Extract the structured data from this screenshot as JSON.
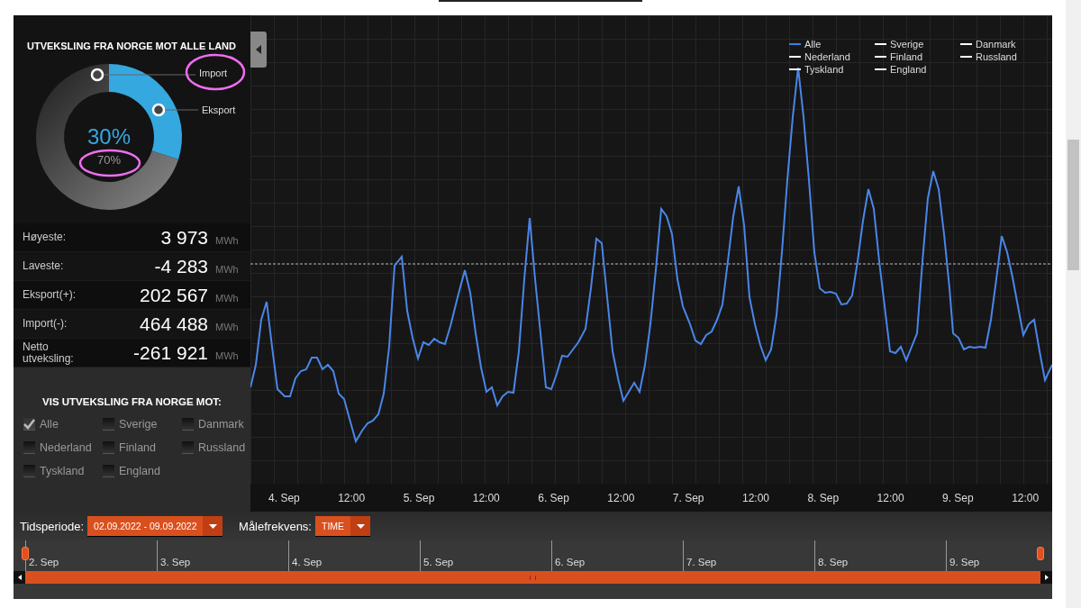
{
  "donut_panel": {
    "title": "UTVEKSLING FRA NORGE MOT ALLE LAND",
    "chart_data": {
      "type": "donut",
      "categories": [
        "Eksport",
        "Import"
      ],
      "values": [
        30,
        70
      ]
    },
    "center_labels": [
      "30%",
      "70%"
    ]
  },
  "stats": [
    {
      "label": "Høyeste:",
      "value": "3 973",
      "unit": "MWh"
    },
    {
      "label": "Laveste:",
      "value": "-4 283",
      "unit": "MWh"
    },
    {
      "label": "Eksport(+):",
      "value": "202 567",
      "unit": "MWh"
    },
    {
      "label": "Import(-):",
      "value": "464 488",
      "unit": "MWh"
    },
    {
      "label": "Netto utveksling:",
      "value": "-261 921",
      "unit": "MWh"
    }
  ],
  "filter": {
    "title": "VIS UTVEKSLING FRA NORGE MOT:",
    "options": [
      {
        "label": "Alle",
        "checked": true
      },
      {
        "label": "Sverige",
        "checked": false
      },
      {
        "label": "Danmark",
        "checked": false
      },
      {
        "label": "Nederland",
        "checked": false
      },
      {
        "label": "Finland",
        "checked": false
      },
      {
        "label": "Russland",
        "checked": false
      },
      {
        "label": "Tyskland",
        "checked": false
      },
      {
        "label": "England",
        "checked": false
      }
    ]
  },
  "chart": {
    "legend": [
      {
        "label": "Alle",
        "color": "#3b7fe0"
      },
      {
        "label": "Sverige",
        "color": "#ffffff"
      },
      {
        "label": "Danmark",
        "color": "#ffffff"
      },
      {
        "label": "Nederland",
        "color": "#ffffff"
      },
      {
        "label": "Finland",
        "color": "#ffffff"
      },
      {
        "label": "Russland",
        "color": "#ffffff"
      },
      {
        "label": "Tyskland",
        "color": "#ffffff"
      },
      {
        "label": "England",
        "color": "#ffffff"
      }
    ],
    "x_labels": [
      "4. Sep",
      "12:00",
      "5. Sep",
      "12:00",
      "6. Sep",
      "12:00",
      "7. Sep",
      "12:00",
      "8. Sep",
      "12:00",
      "9. Sep",
      "12:00"
    ]
  },
  "controls": {
    "period": {
      "label": "Tidsperiode:",
      "value": "02.09.2022 - 09.09.2022"
    },
    "frequency": {
      "label": "Målefrekvens:",
      "value": "TIME"
    }
  },
  "timeline": {
    "labels": [
      "2. Sep",
      "3. Sep",
      "4. Sep",
      "5. Sep",
      "6. Sep",
      "7. Sep",
      "8. Sep",
      "9. Sep"
    ]
  }
}
